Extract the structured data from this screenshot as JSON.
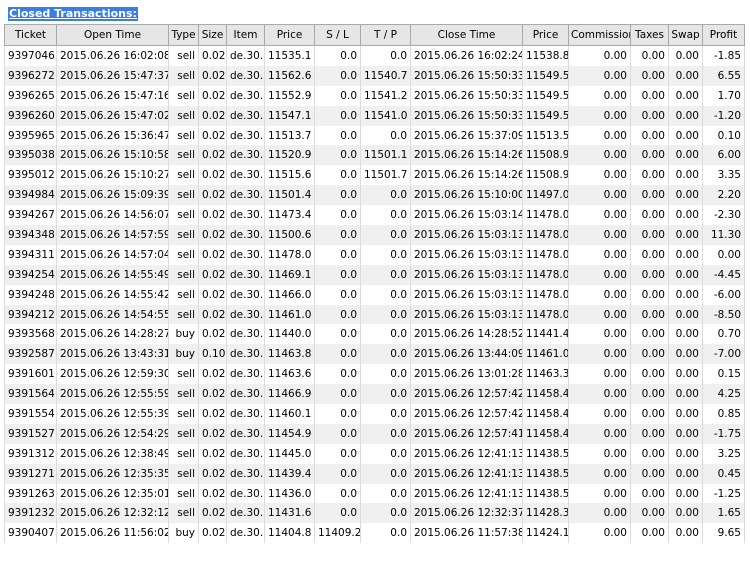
{
  "title": "Closed Transactions:",
  "columns": [
    "Ticket",
    "Open Time",
    "Type",
    "Size",
    "Item",
    "Price",
    "S / L",
    "T / P",
    "Close Time",
    "Price",
    "Commission",
    "Taxes",
    "Swap",
    "Profit"
  ],
  "rows": [
    [
      "9397046",
      "2015.06.26 16:02:08",
      "sell",
      "0.02",
      "de.30.",
      "11535.1",
      "0.0",
      "0.0",
      "2015.06.26 16:02:24",
      "11538.8",
      "0.00",
      "0.00",
      "0.00",
      "-1.85"
    ],
    [
      "9396272",
      "2015.06.26 15:47:37",
      "sell",
      "0.02",
      "de.30.",
      "11562.6",
      "0.0",
      "11540.7",
      "2015.06.26 15:50:33",
      "11549.5",
      "0.00",
      "0.00",
      "0.00",
      "6.55"
    ],
    [
      "9396265",
      "2015.06.26 15:47:16",
      "sell",
      "0.02",
      "de.30.",
      "11552.9",
      "0.0",
      "11541.2",
      "2015.06.26 15:50:33",
      "11549.5",
      "0.00",
      "0.00",
      "0.00",
      "1.70"
    ],
    [
      "9396260",
      "2015.06.26 15:47:02",
      "sell",
      "0.02",
      "de.30.",
      "11547.1",
      "0.0",
      "11541.0",
      "2015.06.26 15:50:33",
      "11549.5",
      "0.00",
      "0.00",
      "0.00",
      "-1.20"
    ],
    [
      "9395965",
      "2015.06.26 15:36:47",
      "sell",
      "0.02",
      "de.30.",
      "11513.7",
      "0.0",
      "0.0",
      "2015.06.26 15:37:09",
      "11513.5",
      "0.00",
      "0.00",
      "0.00",
      "0.10"
    ],
    [
      "9395038",
      "2015.06.26 15:10:58",
      "sell",
      "0.02",
      "de.30.",
      "11520.9",
      "0.0",
      "11501.1",
      "2015.06.26 15:14:26",
      "11508.9",
      "0.00",
      "0.00",
      "0.00",
      "6.00"
    ],
    [
      "9395012",
      "2015.06.26 15:10:27",
      "sell",
      "0.02",
      "de.30.",
      "11515.6",
      "0.0",
      "11501.7",
      "2015.06.26 15:14:26",
      "11508.9",
      "0.00",
      "0.00",
      "0.00",
      "3.35"
    ],
    [
      "9394984",
      "2015.06.26 15:09:39",
      "sell",
      "0.02",
      "de.30.",
      "11501.4",
      "0.0",
      "0.0",
      "2015.06.26 15:10:00",
      "11497.0",
      "0.00",
      "0.00",
      "0.00",
      "2.20"
    ],
    [
      "9394267",
      "2015.06.26 14:56:07",
      "sell",
      "0.02",
      "de.30.",
      "11473.4",
      "0.0",
      "0.0",
      "2015.06.26 15:03:14",
      "11478.0",
      "0.00",
      "0.00",
      "0.00",
      "-2.30"
    ],
    [
      "9394348",
      "2015.06.26 14:57:59",
      "sell",
      "0.02",
      "de.30.",
      "11500.6",
      "0.0",
      "0.0",
      "2015.06.26 15:03:13",
      "11478.0",
      "0.00",
      "0.00",
      "0.00",
      "11.30"
    ],
    [
      "9394311",
      "2015.06.26 14:57:04",
      "sell",
      "0.02",
      "de.30.",
      "11478.0",
      "0.0",
      "0.0",
      "2015.06.26 15:03:13",
      "11478.0",
      "0.00",
      "0.00",
      "0.00",
      "0.00"
    ],
    [
      "9394254",
      "2015.06.26 14:55:49",
      "sell",
      "0.02",
      "de.30.",
      "11469.1",
      "0.0",
      "0.0",
      "2015.06.26 15:03:13",
      "11478.0",
      "0.00",
      "0.00",
      "0.00",
      "-4.45"
    ],
    [
      "9394248",
      "2015.06.26 14:55:42",
      "sell",
      "0.02",
      "de.30.",
      "11466.0",
      "0.0",
      "0.0",
      "2015.06.26 15:03:13",
      "11478.0",
      "0.00",
      "0.00",
      "0.00",
      "-6.00"
    ],
    [
      "9394212",
      "2015.06.26 14:54:55",
      "sell",
      "0.02",
      "de.30.",
      "11461.0",
      "0.0",
      "0.0",
      "2015.06.26 15:03:13",
      "11478.0",
      "0.00",
      "0.00",
      "0.00",
      "-8.50"
    ],
    [
      "9393568",
      "2015.06.26 14:28:27",
      "buy",
      "0.02",
      "de.30.",
      "11440.0",
      "0.0",
      "0.0",
      "2015.06.26 14:28:52",
      "11441.4",
      "0.00",
      "0.00",
      "0.00",
      "0.70"
    ],
    [
      "9392587",
      "2015.06.26 13:43:31",
      "buy",
      "0.10",
      "de.30.",
      "11463.8",
      "0.0",
      "0.0",
      "2015.06.26 13:44:09",
      "11461.0",
      "0.00",
      "0.00",
      "0.00",
      "-7.00"
    ],
    [
      "9391601",
      "2015.06.26 12:59:30",
      "sell",
      "0.02",
      "de.30.",
      "11463.6",
      "0.0",
      "0.0",
      "2015.06.26 13:01:28",
      "11463.3",
      "0.00",
      "0.00",
      "0.00",
      "0.15"
    ],
    [
      "9391564",
      "2015.06.26 12:55:59",
      "sell",
      "0.02",
      "de.30.",
      "11466.9",
      "0.0",
      "0.0",
      "2015.06.26 12:57:42",
      "11458.4",
      "0.00",
      "0.00",
      "0.00",
      "4.25"
    ],
    [
      "9391554",
      "2015.06.26 12:55:39",
      "sell",
      "0.02",
      "de.30.",
      "11460.1",
      "0.0",
      "0.0",
      "2015.06.26 12:57:42",
      "11458.4",
      "0.00",
      "0.00",
      "0.00",
      "0.85"
    ],
    [
      "9391527",
      "2015.06.26 12:54:29",
      "sell",
      "0.02",
      "de.30.",
      "11454.9",
      "0.0",
      "0.0",
      "2015.06.26 12:57:41",
      "11458.4",
      "0.00",
      "0.00",
      "0.00",
      "-1.75"
    ],
    [
      "9391312",
      "2015.06.26 12:38:49",
      "sell",
      "0.02",
      "de.30.",
      "11445.0",
      "0.0",
      "0.0",
      "2015.06.26 12:41:13",
      "11438.5",
      "0.00",
      "0.00",
      "0.00",
      "3.25"
    ],
    [
      "9391271",
      "2015.06.26 12:35:35",
      "sell",
      "0.02",
      "de.30.",
      "11439.4",
      "0.0",
      "0.0",
      "2015.06.26 12:41:13",
      "11438.5",
      "0.00",
      "0.00",
      "0.00",
      "0.45"
    ],
    [
      "9391263",
      "2015.06.26 12:35:01",
      "sell",
      "0.02",
      "de.30.",
      "11436.0",
      "0.0",
      "0.0",
      "2015.06.26 12:41:13",
      "11438.5",
      "0.00",
      "0.00",
      "0.00",
      "-1.25"
    ],
    [
      "9391232",
      "2015.06.26 12:32:12",
      "sell",
      "0.02",
      "de.30.",
      "11431.6",
      "0.0",
      "0.0",
      "2015.06.26 12:32:37",
      "11428.3",
      "0.00",
      "0.00",
      "0.00",
      "1.65"
    ],
    [
      "9390407",
      "2015.06.26 11:56:02",
      "buy",
      "0.02",
      "de.30.",
      "11404.8",
      "11409.2",
      "0.0",
      "2015.06.26 11:57:38",
      "11424.1",
      "0.00",
      "0.00",
      "0.00",
      "9.65"
    ]
  ]
}
